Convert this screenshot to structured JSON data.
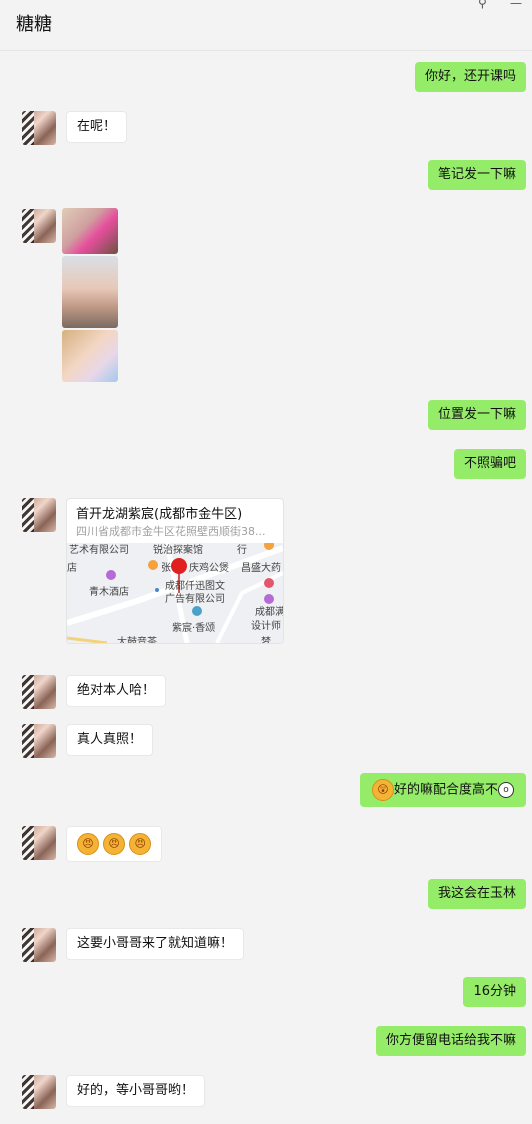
{
  "header": {
    "title": "糖糖",
    "pin_icon": "pin-icon",
    "minimize_icon": "minimize-icon"
  },
  "messages": [
    {
      "side": "out",
      "text": "你好，还开课吗"
    },
    {
      "side": "in",
      "text": "在呢！"
    },
    {
      "side": "out",
      "text": "笔记发一下嘛"
    },
    {
      "side": "in",
      "type": "photos",
      "count": 3
    },
    {
      "side": "out",
      "text": "位置发一下嘛"
    },
    {
      "side": "out",
      "text": "不照骗吧"
    },
    {
      "side": "in",
      "type": "location"
    },
    {
      "side": "in",
      "text": "绝对本人哈！"
    },
    {
      "side": "in",
      "text": "真人真照！"
    },
    {
      "side": "out",
      "text": "好的嘛配合度高不"
    },
    {
      "side": "in",
      "type": "emoji",
      "count": 3
    },
    {
      "side": "out",
      "text": "我这会在玉林"
    },
    {
      "side": "in",
      "text": "这要小哥哥来了就知道嘛！"
    },
    {
      "side": "out",
      "text": "16分钟"
    },
    {
      "side": "out",
      "text": "你方便留电话给我不嘛"
    },
    {
      "side": "in",
      "text": "好的，等小哥哥哟！"
    }
  ],
  "location": {
    "name": "首开龙湖紫宸(成都市金牛区)",
    "address": "四川省成都市金牛区花照壁西顺街38...",
    "map_labels": [
      "艺术有限公司",
      "锐治探案馆",
      "行",
      "店",
      "张",
      "庆鸡公煲",
      "昌盛大药",
      "青木酒店",
      "成都仟迅图文",
      "广告有限公司",
      "成都满",
      "紫宸·香颂",
      "设计师",
      "大鼓音茶",
      "梦"
    ]
  },
  "colors": {
    "out_bubble": "#95ec69",
    "in_bubble": "#ffffff",
    "background": "#f3f3f3",
    "map_pin": "#e02020"
  }
}
